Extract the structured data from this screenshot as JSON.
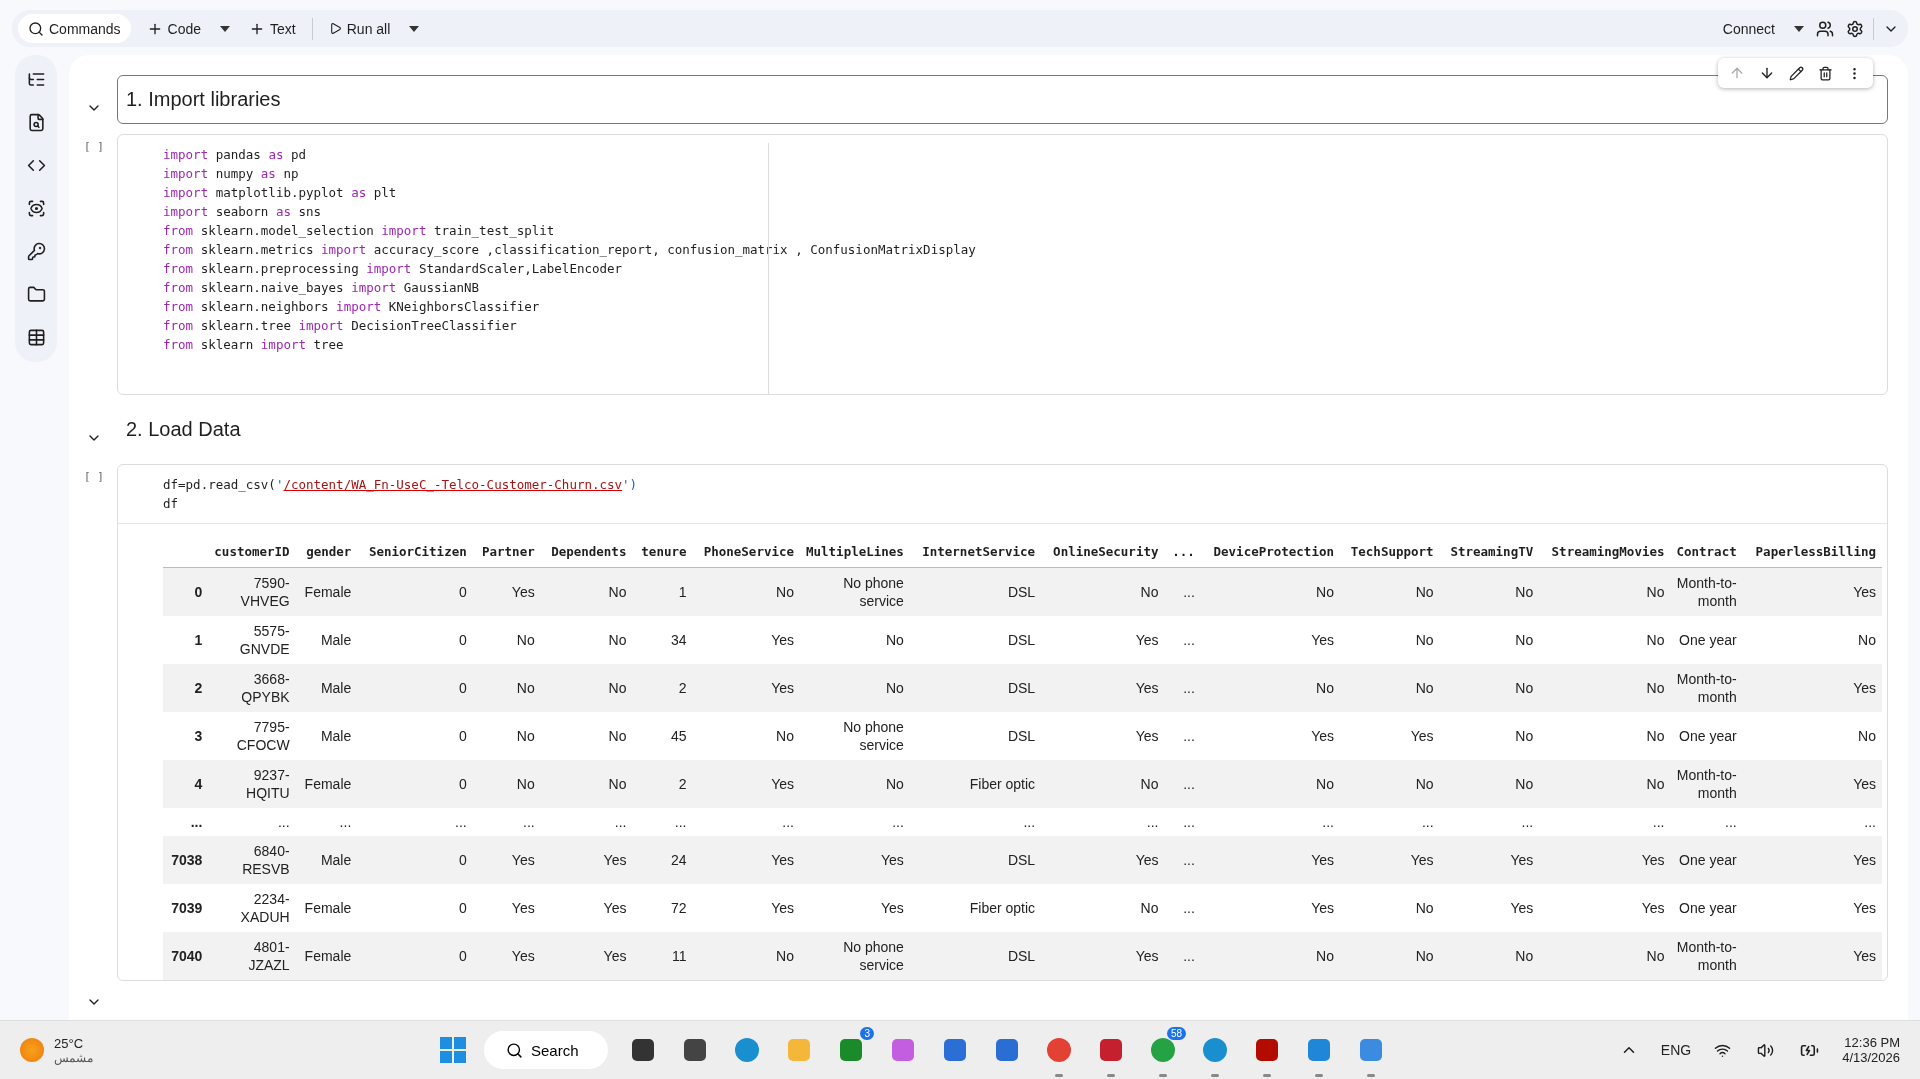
{
  "toolbar": {
    "left": [
      {
        "kind": "search",
        "label": "Commands"
      },
      {
        "kind": "add",
        "label": "Code",
        "dropdown": true
      },
      {
        "kind": "add",
        "label": "Text",
        "dropdown": false
      },
      {
        "kind": "run",
        "label": "Run all",
        "dropdown": true
      }
    ],
    "connect": "Connect"
  },
  "cells": [
    {
      "kind": "heading",
      "title": "1. Import libraries",
      "expanded": true,
      "toolbar": true
    },
    {
      "kind": "code",
      "prompt": "[ ]",
      "lines": [
        [
          {
            "text": "import",
            "kind": "keyword"
          },
          {
            "text": " pandas ",
            "kind": "plain"
          },
          {
            "text": "as",
            "kind": "keyword"
          },
          {
            "text": " pd",
            "kind": "plain"
          }
        ],
        [
          {
            "text": "import",
            "kind": "keyword"
          },
          {
            "text": " numpy ",
            "kind": "plain"
          },
          {
            "text": "as",
            "kind": "keyword"
          },
          {
            "text": " np",
            "kind": "plain"
          }
        ],
        [
          {
            "text": "import",
            "kind": "keyword"
          },
          {
            "text": " matplotlib.pyplot ",
            "kind": "plain"
          },
          {
            "text": "as",
            "kind": "keyword"
          },
          {
            "text": " plt",
            "kind": "plain"
          }
        ],
        [
          {
            "text": "import",
            "kind": "keyword"
          },
          {
            "text": " seaborn ",
            "kind": "plain"
          },
          {
            "text": "as",
            "kind": "keyword"
          },
          {
            "text": " sns",
            "kind": "plain"
          }
        ],
        [
          {
            "text": "from",
            "kind": "keyword"
          },
          {
            "text": " sklearn.model_selection ",
            "kind": "plain"
          },
          {
            "text": "import",
            "kind": "keyword"
          },
          {
            "text": " train_test_split",
            "kind": "plain"
          }
        ],
        [
          {
            "text": "from",
            "kind": "keyword"
          },
          {
            "text": " sklearn.metrics ",
            "kind": "plain"
          },
          {
            "text": "import",
            "kind": "keyword"
          },
          {
            "text": " accuracy_score ,classification_report, confusion_matrix , ConfusionMatrixDisplay",
            "kind": "plain"
          }
        ],
        [
          {
            "text": "from",
            "kind": "keyword"
          },
          {
            "text": " sklearn.preprocessing ",
            "kind": "plain"
          },
          {
            "text": "import",
            "kind": "keyword"
          },
          {
            "text": " StandardScaler,LabelEncoder",
            "kind": "plain"
          }
        ],
        [
          {
            "text": "from",
            "kind": "keyword"
          },
          {
            "text": " sklearn.naive_bayes ",
            "kind": "plain"
          },
          {
            "text": "import",
            "kind": "keyword"
          },
          {
            "text": " GaussianNB",
            "kind": "plain"
          }
        ],
        [
          {
            "text": "from",
            "kind": "keyword"
          },
          {
            "text": " sklearn.neighbors ",
            "kind": "plain"
          },
          {
            "text": "import",
            "kind": "keyword"
          },
          {
            "text": " KNeighborsClassifier",
            "kind": "plain"
          }
        ],
        [
          {
            "text": "from",
            "kind": "keyword"
          },
          {
            "text": " sklearn.tree ",
            "kind": "plain"
          },
          {
            "text": "import",
            "kind": "keyword"
          },
          {
            "text": " DecisionTreeClassifier",
            "kind": "plain"
          }
        ],
        [
          {
            "text": "from",
            "kind": "keyword"
          },
          {
            "text": " sklearn ",
            "kind": "plain"
          },
          {
            "text": "import",
            "kind": "keyword"
          },
          {
            "text": " tree",
            "kind": "plain"
          }
        ]
      ]
    },
    {
      "kind": "heading",
      "title": "2. Load Data",
      "expanded": true,
      "toolbar": false
    },
    {
      "kind": "code",
      "prompt": "[ ]",
      "lines": [
        [
          {
            "text": "df=pd.read_csv(",
            "kind": "plain"
          },
          {
            "text": "'",
            "kind": "punct"
          },
          {
            "text": "/content/WA_Fn-UseC_-Telco-Customer-Churn.csv",
            "kind": "string"
          },
          {
            "text": "'",
            "kind": "punct"
          },
          {
            "text": ")",
            "kind": "punct"
          }
        ],
        [
          {
            "text": "df",
            "kind": "plain"
          }
        ]
      ],
      "output": {
        "expanded": true,
        "columns": [
          "",
          "customerID",
          "gender",
          "SeniorCitizen",
          "Partner",
          "Dependents",
          "tenure",
          "PhoneService",
          "MultipleLines",
          "InternetService",
          "OnlineSecurity",
          "...",
          "DeviceProtection",
          "TechSupport",
          "StreamingTV",
          "StreamingMovies",
          "Contract",
          "PaperlessBilling"
        ],
        "rows": [
          [
            "0",
            "7590-VHVEG",
            "Female",
            "0",
            "Yes",
            "No",
            "1",
            "No",
            "No phone service",
            "DSL",
            "No",
            "...",
            "No",
            "No",
            "No",
            "No",
            "Month-to-month",
            "Yes"
          ],
          [
            "1",
            "5575-GNVDE",
            "Male",
            "0",
            "No",
            "No",
            "34",
            "Yes",
            "No",
            "DSL",
            "Yes",
            "...",
            "Yes",
            "No",
            "No",
            "No",
            "One year",
            "No"
          ],
          [
            "2",
            "3668-QPYBK",
            "Male",
            "0",
            "No",
            "No",
            "2",
            "Yes",
            "No",
            "DSL",
            "Yes",
            "...",
            "No",
            "No",
            "No",
            "No",
            "Month-to-month",
            "Yes"
          ],
          [
            "3",
            "7795-CFOCW",
            "Male",
            "0",
            "No",
            "No",
            "45",
            "No",
            "No phone service",
            "DSL",
            "Yes",
            "...",
            "Yes",
            "Yes",
            "No",
            "No",
            "One year",
            "No"
          ],
          [
            "4",
            "9237-HQITU",
            "Female",
            "0",
            "No",
            "No",
            "2",
            "Yes",
            "No",
            "Fiber optic",
            "No",
            "...",
            "No",
            "No",
            "No",
            "No",
            "Month-to-month",
            "Yes"
          ],
          [
            "...",
            "...",
            "...",
            "...",
            "...",
            "...",
            "...",
            "...",
            "...",
            "...",
            "...",
            "...",
            "...",
            "...",
            "...",
            "...",
            "...",
            "..."
          ],
          [
            "7038",
            "6840-RESVB",
            "Male",
            "0",
            "Yes",
            "Yes",
            "24",
            "Yes",
            "Yes",
            "DSL",
            "Yes",
            "...",
            "Yes",
            "Yes",
            "Yes",
            "Yes",
            "One year",
            "Yes"
          ],
          [
            "7039",
            "2234-XADUH",
            "Female",
            "0",
            "Yes",
            "Yes",
            "72",
            "Yes",
            "Yes",
            "Fiber optic",
            "No",
            "...",
            "Yes",
            "No",
            "Yes",
            "Yes",
            "One year",
            "Yes"
          ],
          [
            "7040",
            "4801-JZAZL",
            "Female",
            "0",
            "Yes",
            "Yes",
            "11",
            "No",
            "No phone service",
            "DSL",
            "Yes",
            "...",
            "No",
            "No",
            "No",
            "No",
            "Month-to-month",
            "Yes"
          ]
        ]
      }
    }
  ],
  "taskbar": {
    "weather": {
      "temp": "25°C",
      "condition": "مشمس"
    },
    "search": "Search",
    "apps": [
      {
        "kind": "taskview",
        "running": false
      },
      {
        "kind": "hex",
        "running": false
      },
      {
        "kind": "edge",
        "running": false
      },
      {
        "kind": "folder",
        "running": false
      },
      {
        "kind": "xbox",
        "running": false,
        "badge": "3"
      },
      {
        "kind": "copilot",
        "running": false
      },
      {
        "kind": "store",
        "running": false
      },
      {
        "kind": "mail",
        "running": false
      },
      {
        "kind": "chrome",
        "running": true
      },
      {
        "kind": "shield",
        "running": true
      },
      {
        "kind": "whatsapp",
        "running": true,
        "badge": "58"
      },
      {
        "kind": "edge",
        "running": true
      },
      {
        "kind": "pdf",
        "running": true
      },
      {
        "kind": "vscode",
        "running": true
      },
      {
        "kind": "photos",
        "running": true
      }
    ],
    "lang": "ENG",
    "time": "12:36 PM",
    "date": "4/13/2026"
  }
}
